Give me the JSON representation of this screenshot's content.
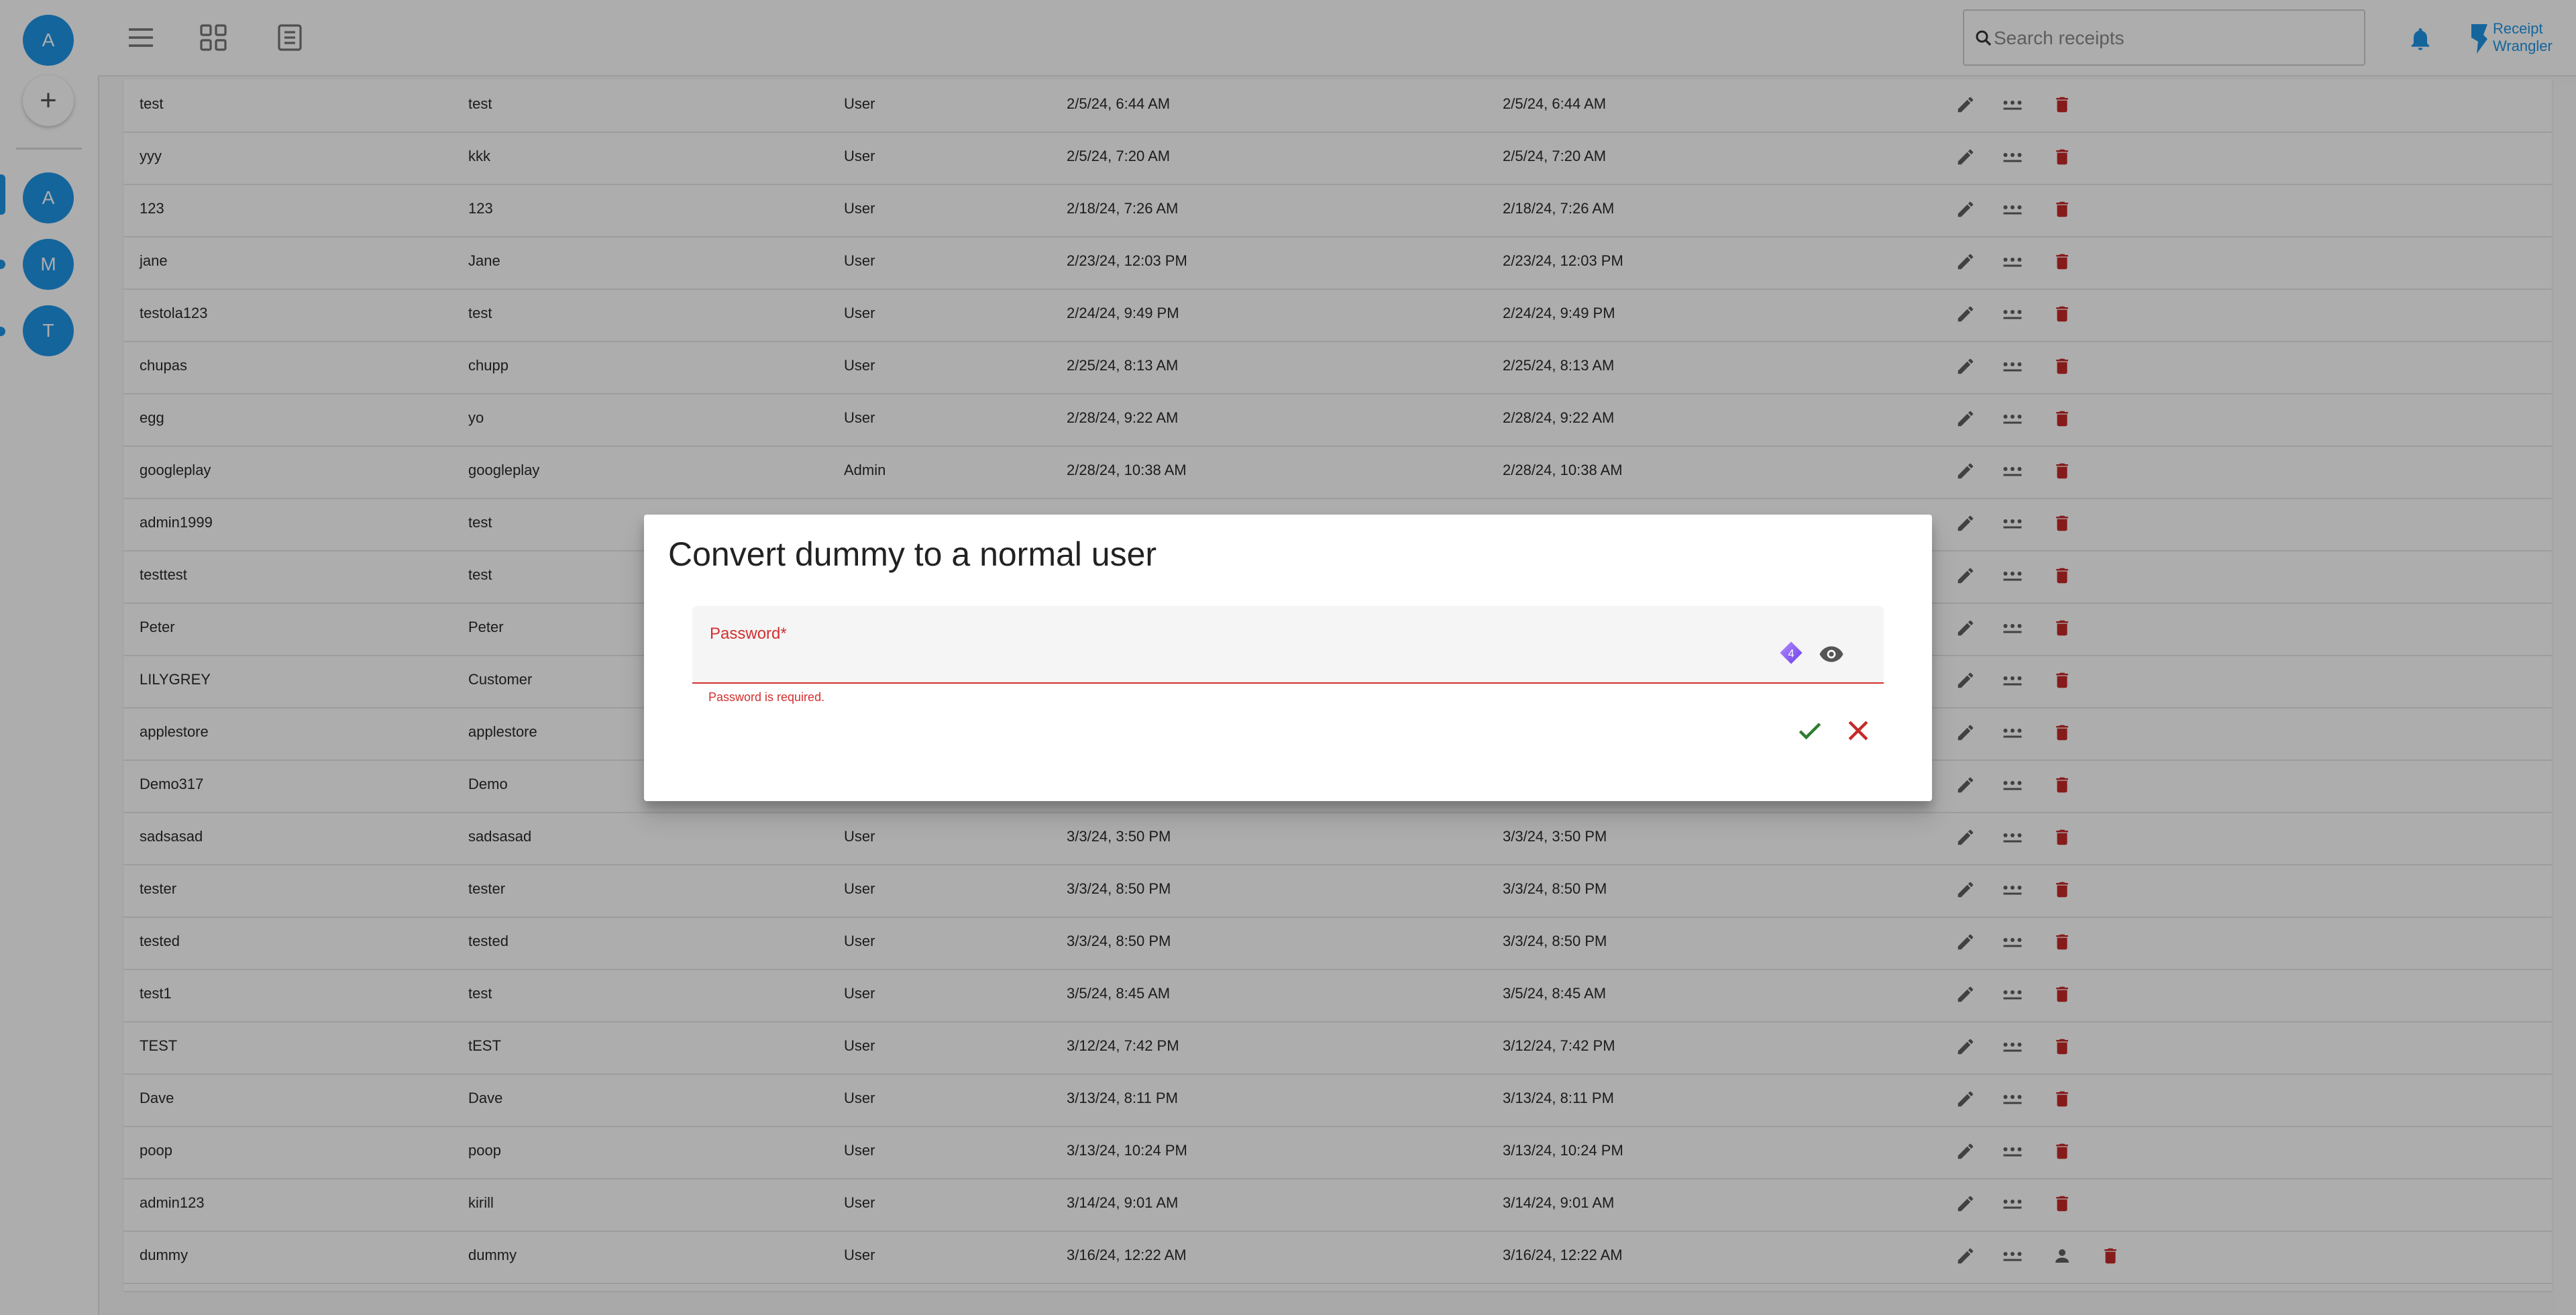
{
  "rail": {
    "current_avatar": "A",
    "add_label": "+",
    "groups": [
      "A",
      "M",
      "T"
    ]
  },
  "topbar": {
    "search_placeholder": "Search receipts",
    "logo_line1": "Receipt",
    "logo_line2": "Wrangler"
  },
  "table": {
    "rows": [
      {
        "username": "test",
        "display_name": "test",
        "role": "User",
        "created": "2/5/24, 6:44 AM",
        "updated": "2/5/24, 6:44 AM",
        "dummy": false
      },
      {
        "username": "yyy",
        "display_name": "kkk",
        "role": "User",
        "created": "2/5/24, 7:20 AM",
        "updated": "2/5/24, 7:20 AM",
        "dummy": false
      },
      {
        "username": "123",
        "display_name": "123",
        "role": "User",
        "created": "2/18/24, 7:26 AM",
        "updated": "2/18/24, 7:26 AM",
        "dummy": false
      },
      {
        "username": "jane",
        "display_name": "Jane",
        "role": "User",
        "created": "2/23/24, 12:03 PM",
        "updated": "2/23/24, 12:03 PM",
        "dummy": false
      },
      {
        "username": "testola123",
        "display_name": "test",
        "role": "User",
        "created": "2/24/24, 9:49 PM",
        "updated": "2/24/24, 9:49 PM",
        "dummy": false
      },
      {
        "username": "chupas",
        "display_name": "chupp",
        "role": "User",
        "created": "2/25/24, 8:13 AM",
        "updated": "2/25/24, 8:13 AM",
        "dummy": false
      },
      {
        "username": "egg",
        "display_name": "yo",
        "role": "User",
        "created": "2/28/24, 9:22 AM",
        "updated": "2/28/24, 9:22 AM",
        "dummy": false
      },
      {
        "username": "googleplay",
        "display_name": "googleplay",
        "role": "Admin",
        "created": "2/28/24, 10:38 AM",
        "updated": "2/28/24, 10:38 AM",
        "dummy": false
      },
      {
        "username": "admin1999",
        "display_name": "test",
        "role": "",
        "created": "",
        "updated": "",
        "dummy": false
      },
      {
        "username": "testtest",
        "display_name": "test",
        "role": "",
        "created": "",
        "updated": "",
        "dummy": false
      },
      {
        "username": "Peter",
        "display_name": "Peter",
        "role": "",
        "created": "",
        "updated": "",
        "dummy": false
      },
      {
        "username": "LILYGREY",
        "display_name": "Customer",
        "role": "",
        "created": "",
        "updated": "",
        "dummy": false
      },
      {
        "username": "applestore",
        "display_name": "applestore",
        "role": "",
        "created": "",
        "updated": "",
        "dummy": false
      },
      {
        "username": "Demo317",
        "display_name": "Demo",
        "role": "",
        "created": "",
        "updated": "",
        "dummy": false
      },
      {
        "username": "sadsasad",
        "display_name": "sadsasad",
        "role": "User",
        "created": "3/3/24, 3:50 PM",
        "updated": "3/3/24, 3:50 PM",
        "dummy": false
      },
      {
        "username": "tester",
        "display_name": "tester",
        "role": "User",
        "created": "3/3/24, 8:50 PM",
        "updated": "3/3/24, 8:50 PM",
        "dummy": false
      },
      {
        "username": "tested",
        "display_name": "tested",
        "role": "User",
        "created": "3/3/24, 8:50 PM",
        "updated": "3/3/24, 8:50 PM",
        "dummy": false
      },
      {
        "username": "test1",
        "display_name": "test",
        "role": "User",
        "created": "3/5/24, 8:45 AM",
        "updated": "3/5/24, 8:45 AM",
        "dummy": false
      },
      {
        "username": "TEST",
        "display_name": "tEST",
        "role": "User",
        "created": "3/12/24, 7:42 PM",
        "updated": "3/12/24, 7:42 PM",
        "dummy": false
      },
      {
        "username": "Dave",
        "display_name": "Dave",
        "role": "User",
        "created": "3/13/24, 8:11 PM",
        "updated": "3/13/24, 8:11 PM",
        "dummy": false
      },
      {
        "username": "poop",
        "display_name": "poop",
        "role": "User",
        "created": "3/13/24, 10:24 PM",
        "updated": "3/13/24, 10:24 PM",
        "dummy": false
      },
      {
        "username": "admin123",
        "display_name": "kirill",
        "role": "User",
        "created": "3/14/24, 9:01 AM",
        "updated": "3/14/24, 9:01 AM",
        "dummy": false
      },
      {
        "username": "dummy",
        "display_name": "dummy",
        "role": "User",
        "created": "3/16/24, 12:22 AM",
        "updated": "3/16/24, 12:22 AM",
        "dummy": true
      }
    ]
  },
  "dialog": {
    "title": "Convert dummy to a normal user",
    "password_label": "Password",
    "required_marker": "*",
    "password_value": "",
    "error_text": "Password is required.",
    "strength_badge": "4"
  },
  "colors": {
    "accent": "#1e96e6",
    "error": "#d32f2f",
    "confirm": "#2e7d32",
    "delete": "#c62828",
    "icon_gray": "#616161"
  }
}
